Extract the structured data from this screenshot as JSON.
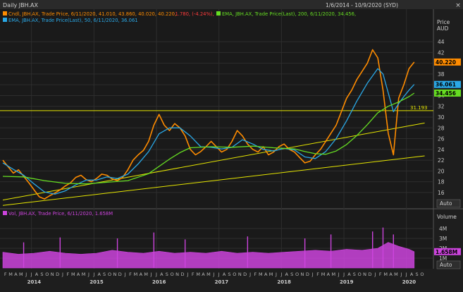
{
  "header": {
    "title": "Daily JBH.AX",
    "date_range": "1/6/2014 - 10/9/2020 (SYD)",
    "close_label": "×"
  },
  "legend": {
    "candle": {
      "label": "Cndl, JBH.AX, Trade Price, 6/11/2020, 41.010, 43.860, 40.020, 40.220,",
      "change": "-1.780, (-4.24%),",
      "color": "#ff8c00"
    },
    "ema200": {
      "label": "EMA, JBH.AX, Trade Price(Last), 200, 6/11/2020, 34.456,",
      "color": "#66dd22"
    },
    "ema50": {
      "label": "EMA, JBH.AX, Trade Price(Last), 50, 6/11/2020, 36.061",
      "color": "#2aa8e6"
    },
    "volume": {
      "label": "Vol, JBH.AX, Trade Price, 6/11/2020, 1.658M",
      "color": "#cc44dd"
    }
  },
  "axis": {
    "price_title": "Price",
    "price_unit": "AUD",
    "auto_label": "Auto",
    "volume_title": "Volume",
    "volume_auto_label": "Auto"
  },
  "chart_data": {
    "type": "line",
    "x_range": [
      "2014-01",
      "2020-10"
    ],
    "price_ticks": [
      16,
      18,
      20,
      22,
      24,
      26,
      28,
      30,
      32,
      34,
      36,
      38,
      40,
      42,
      44
    ],
    "price_range": [
      13.5,
      46.5
    ],
    "volume_ticks": [
      {
        "value": 1,
        "label": "1M"
      },
      {
        "value": 2,
        "label": "2M"
      },
      {
        "value": 3,
        "label": "3M"
      },
      {
        "value": 4,
        "label": "4M"
      }
    ],
    "volume_range": [
      0,
      5
    ],
    "month_letters": "FMAMJJASONDJFMAMJJASONDJFMAMJJASONDJFMAMJJASONDJFMAMJJASONDJFMAMJJASONDJFMAMJJASO",
    "years": [
      {
        "label": "2014",
        "month_index": 6
      },
      {
        "label": "2015",
        "month_index": 18
      },
      {
        "label": "2016",
        "month_index": 30
      },
      {
        "label": "2017",
        "month_index": 42
      },
      {
        "label": "2018",
        "month_index": 54
      },
      {
        "label": "2019",
        "month_index": 66
      },
      {
        "label": "2020",
        "month_index": 78
      }
    ],
    "price_tags": [
      {
        "value": 40.22,
        "label": "40.220",
        "bg": "#ff8c00",
        "fg": "#000000"
      },
      {
        "value": 36.061,
        "label": "36.061",
        "bg": "#2aa8e6",
        "fg": "#000000"
      },
      {
        "value": 34.456,
        "label": "34.456",
        "bg": "#66dd22",
        "fg": "#000000"
      }
    ],
    "volume_tag": {
      "value": 1.658,
      "label": "1.658M",
      "bg": "#cc44dd",
      "fg": "#000000"
    },
    "horizontal_line": {
      "value": 31.193,
      "label": "31.193",
      "color": "#e6e600"
    },
    "trendlines": [
      {
        "name": "upper",
        "points": [
          [
            0,
            14.6
          ],
          [
            81,
            28.9
          ]
        ],
        "color": "#e6e600"
      },
      {
        "name": "lower",
        "points": [
          [
            0,
            13.6
          ],
          [
            81,
            22.8
          ]
        ],
        "color": "#e6e600"
      }
    ],
    "series": [
      {
        "name": "Price",
        "color": "#ff8c00",
        "points": [
          [
            0,
            22.0
          ],
          [
            1,
            20.8
          ],
          [
            2,
            19.6
          ],
          [
            3,
            20.2
          ],
          [
            4,
            19.0
          ],
          [
            5,
            17.8
          ],
          [
            6,
            16.5
          ],
          [
            7,
            15.2
          ],
          [
            8,
            14.8
          ],
          [
            9,
            15.4
          ],
          [
            10,
            15.9
          ],
          [
            11,
            16.5
          ],
          [
            12,
            17.2
          ],
          [
            13,
            17.8
          ],
          [
            14,
            18.8
          ],
          [
            15,
            19.2
          ],
          [
            16,
            18.4
          ],
          [
            17,
            18.0
          ],
          [
            18,
            18.6
          ],
          [
            19,
            19.4
          ],
          [
            20,
            19.2
          ],
          [
            21,
            18.5
          ],
          [
            22,
            18.2
          ],
          [
            23,
            18.8
          ],
          [
            24,
            20.2
          ],
          [
            25,
            22.0
          ],
          [
            26,
            23.0
          ],
          [
            27,
            23.8
          ],
          [
            28,
            25.5
          ],
          [
            29,
            28.5
          ],
          [
            30,
            30.5
          ],
          [
            31,
            28.5
          ],
          [
            32,
            27.5
          ],
          [
            33,
            28.8
          ],
          [
            34,
            28.0
          ],
          [
            35,
            26.5
          ],
          [
            36,
            24.0
          ],
          [
            37,
            23.0
          ],
          [
            38,
            23.6
          ],
          [
            39,
            24.5
          ],
          [
            40,
            25.5
          ],
          [
            41,
            24.5
          ],
          [
            42,
            23.5
          ],
          [
            43,
            24.0
          ],
          [
            44,
            25.5
          ],
          [
            45,
            27.5
          ],
          [
            46,
            26.5
          ],
          [
            47,
            25.0
          ],
          [
            48,
            24.0
          ],
          [
            49,
            23.5
          ],
          [
            50,
            24.5
          ],
          [
            51,
            23.0
          ],
          [
            52,
            23.5
          ],
          [
            53,
            24.5
          ],
          [
            54,
            25.0
          ],
          [
            55,
            24.0
          ],
          [
            56,
            23.5
          ],
          [
            57,
            22.5
          ],
          [
            58,
            21.5
          ],
          [
            59,
            21.8
          ],
          [
            60,
            23.0
          ],
          [
            61,
            24.0
          ],
          [
            62,
            25.5
          ],
          [
            63,
            27.0
          ],
          [
            64,
            28.5
          ],
          [
            65,
            31.0
          ],
          [
            66,
            33.5
          ],
          [
            67,
            35.0
          ],
          [
            68,
            37.0
          ],
          [
            69,
            38.5
          ],
          [
            70,
            40.0
          ],
          [
            71,
            42.5
          ],
          [
            72,
            41.0
          ],
          [
            73,
            35.0
          ],
          [
            74,
            27.0
          ],
          [
            75,
            23.0
          ],
          [
            76,
            33.5
          ],
          [
            77,
            36.0
          ],
          [
            78,
            39.0
          ],
          [
            79,
            40.22
          ]
        ]
      },
      {
        "name": "EMA 50",
        "color": "#2aa8e6",
        "points": [
          [
            0,
            21.5
          ],
          [
            2,
            20.3
          ],
          [
            4,
            19.2
          ],
          [
            6,
            17.6
          ],
          [
            8,
            16.1
          ],
          [
            10,
            15.7
          ],
          [
            12,
            16.3
          ],
          [
            14,
            17.4
          ],
          [
            16,
            18.3
          ],
          [
            18,
            18.3
          ],
          [
            20,
            18.9
          ],
          [
            22,
            18.6
          ],
          [
            24,
            19.4
          ],
          [
            26,
            21.3
          ],
          [
            28,
            23.6
          ],
          [
            30,
            26.9
          ],
          [
            32,
            28.0
          ],
          [
            34,
            28.0
          ],
          [
            36,
            26.5
          ],
          [
            38,
            24.5
          ],
          [
            40,
            24.4
          ],
          [
            42,
            24.1
          ],
          [
            44,
            24.4
          ],
          [
            46,
            25.8
          ],
          [
            48,
            25.0
          ],
          [
            50,
            24.0
          ],
          [
            52,
            23.7
          ],
          [
            54,
            24.2
          ],
          [
            56,
            23.9
          ],
          [
            58,
            22.6
          ],
          [
            60,
            22.3
          ],
          [
            62,
            23.6
          ],
          [
            64,
            26.0
          ],
          [
            66,
            29.3
          ],
          [
            68,
            33.0
          ],
          [
            70,
            36.3
          ],
          [
            72,
            39.0
          ],
          [
            73,
            38.0
          ],
          [
            74,
            34.5
          ],
          [
            75,
            31.0
          ],
          [
            76,
            32.5
          ],
          [
            77,
            33.8
          ],
          [
            78,
            35.0
          ],
          [
            79,
            36.061
          ]
        ]
      },
      {
        "name": "EMA 200",
        "color": "#66dd22",
        "points": [
          [
            0,
            19.0
          ],
          [
            4,
            18.9
          ],
          [
            8,
            18.2
          ],
          [
            12,
            17.7
          ],
          [
            16,
            17.6
          ],
          [
            20,
            17.9
          ],
          [
            24,
            18.2
          ],
          [
            28,
            19.5
          ],
          [
            32,
            22.2
          ],
          [
            34,
            23.4
          ],
          [
            36,
            24.3
          ],
          [
            40,
            24.5
          ],
          [
            44,
            24.4
          ],
          [
            48,
            24.6
          ],
          [
            52,
            24.3
          ],
          [
            56,
            24.1
          ],
          [
            58,
            23.6
          ],
          [
            60,
            23.2
          ],
          [
            62,
            23.1
          ],
          [
            64,
            23.7
          ],
          [
            66,
            24.9
          ],
          [
            68,
            26.6
          ],
          [
            70,
            28.6
          ],
          [
            72,
            30.8
          ],
          [
            74,
            32.0
          ],
          [
            76,
            32.8
          ],
          [
            78,
            33.8
          ],
          [
            79,
            34.456
          ]
        ]
      },
      {
        "name": "Volume",
        "color": "#cc44dd",
        "points": [
          [
            0,
            1.6
          ],
          [
            3,
            1.4
          ],
          [
            6,
            1.5
          ],
          [
            9,
            1.7
          ],
          [
            12,
            1.5
          ],
          [
            15,
            1.4
          ],
          [
            18,
            1.5
          ],
          [
            21,
            1.8
          ],
          [
            24,
            1.6
          ],
          [
            27,
            1.5
          ],
          [
            30,
            1.7
          ],
          [
            33,
            1.5
          ],
          [
            36,
            1.6
          ],
          [
            39,
            1.5
          ],
          [
            42,
            1.7
          ],
          [
            45,
            1.5
          ],
          [
            48,
            1.6
          ],
          [
            51,
            1.5
          ],
          [
            54,
            1.6
          ],
          [
            57,
            1.7
          ],
          [
            60,
            1.8
          ],
          [
            63,
            1.7
          ],
          [
            66,
            1.9
          ],
          [
            69,
            1.8
          ],
          [
            72,
            2.0
          ],
          [
            74,
            2.6
          ],
          [
            76,
            2.2
          ],
          [
            78,
            1.9
          ],
          [
            79,
            1.658
          ]
        ]
      }
    ],
    "volume_spikes": [
      [
        4,
        2.6
      ],
      [
        11,
        3.1
      ],
      [
        22,
        3.0
      ],
      [
        29,
        3.6
      ],
      [
        35,
        2.9
      ],
      [
        47,
        3.2
      ],
      [
        58,
        3.0
      ],
      [
        63,
        3.4
      ],
      [
        71,
        3.7
      ],
      [
        73,
        4.1
      ],
      [
        75,
        3.4
      ]
    ]
  }
}
